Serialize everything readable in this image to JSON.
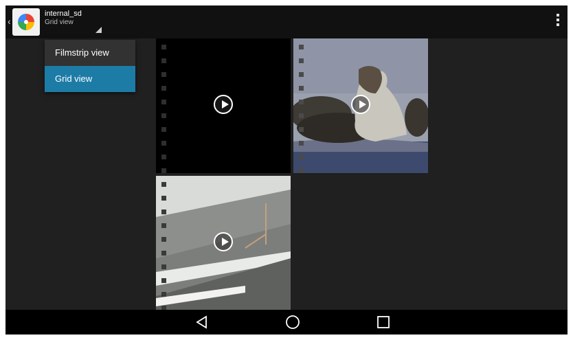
{
  "actionbar": {
    "title": "internal_sd",
    "subtitle": "Grid view"
  },
  "view_menu": {
    "items": [
      {
        "label": "Filmstrip view",
        "selected": false
      },
      {
        "label": "Grid view",
        "selected": true
      }
    ]
  },
  "media_grid": {
    "items": [
      {
        "type": "video",
        "thumbnail": "black"
      },
      {
        "type": "video",
        "thumbnail": "sea lions on beach"
      },
      {
        "type": "video",
        "thumbnail": "ceiling beams"
      }
    ]
  },
  "navbar": {
    "icons": [
      "back-icon",
      "home-icon",
      "recents-icon"
    ]
  },
  "colors": {
    "menu_selected": "#1d7ca6",
    "background": "#202020",
    "actionbar": "#111111"
  }
}
